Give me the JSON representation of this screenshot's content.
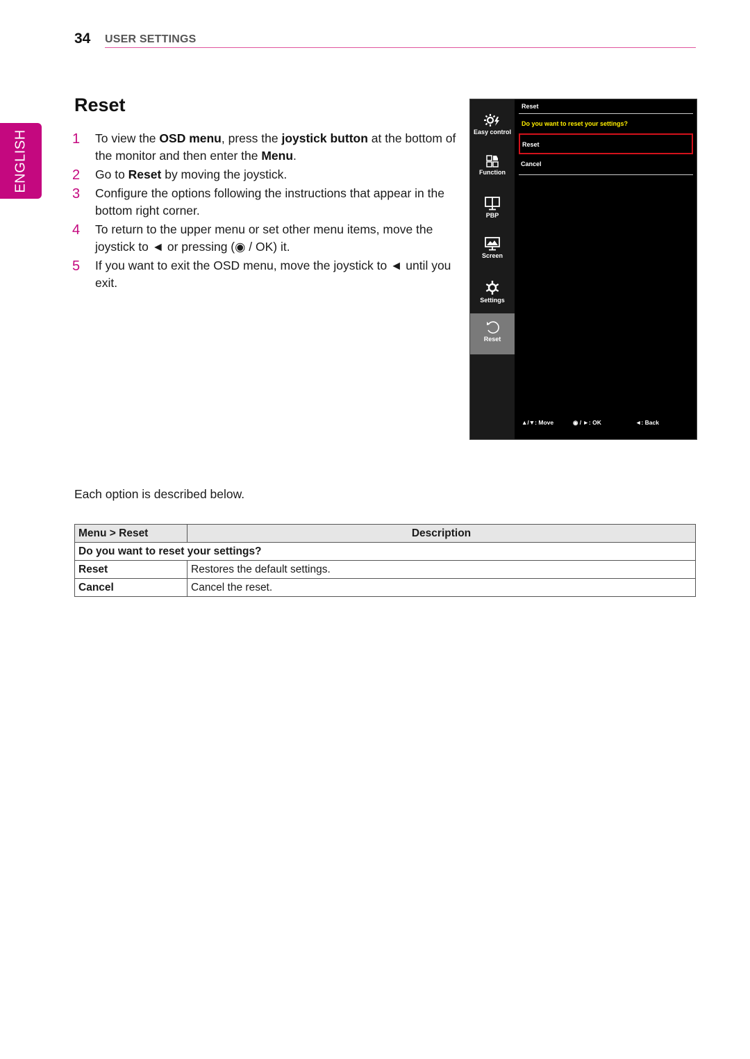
{
  "header": {
    "page_number": "34",
    "section_title": "USER SETTINGS"
  },
  "language_tab": "ENGLISH",
  "heading": "Reset",
  "steps": [
    {
      "num": "1",
      "parts": [
        [
          "To view the ",
          false
        ],
        [
          "OSD menu",
          true
        ],
        [
          ", press the ",
          false
        ],
        [
          "joystick button",
          true
        ],
        [
          " at the bottom of the monitor and then enter the ",
          false
        ],
        [
          "Menu",
          true
        ],
        [
          ".",
          false
        ]
      ]
    },
    {
      "num": "2",
      "parts": [
        [
          "Go to ",
          false
        ],
        [
          "Reset",
          true
        ],
        [
          " by moving the joystick.",
          false
        ]
      ]
    },
    {
      "num": "3",
      "parts": [
        [
          "Configure the options following the instructions that appear in the bottom right corner.",
          false
        ]
      ]
    },
    {
      "num": "4",
      "parts": [
        [
          "To return to the upper menu or set other menu items, move the joystick to ◄ or pressing (◉ / OK) it.",
          false
        ]
      ]
    },
    {
      "num": "5",
      "parts": [
        [
          "If you want to exit the OSD menu, move the joystick to ◄ until you exit.",
          false
        ]
      ]
    }
  ],
  "osd": {
    "sidebar": [
      {
        "label": "Easy control",
        "icon": "easy-control-icon"
      },
      {
        "label": "Function",
        "icon": "function-icon"
      },
      {
        "label": "PBP",
        "icon": "pbp-icon"
      },
      {
        "label": "Screen",
        "icon": "screen-icon"
      },
      {
        "label": "Settings",
        "icon": "settings-icon"
      },
      {
        "label": "Reset",
        "icon": "reset-icon",
        "active": true
      }
    ],
    "title": "Reset",
    "question": "Do you want to reset your settings?",
    "options": [
      {
        "label": "Reset",
        "selected": true
      },
      {
        "label": "Cancel",
        "selected": false
      }
    ],
    "footer": {
      "move": "▲/▼: Move",
      "ok": "◉ / ►: OK",
      "back": "◄: Back"
    },
    "colors": {
      "highlight": "#d3121b",
      "question": "#ffee00"
    }
  },
  "intro": "Each option is described below.",
  "table": {
    "headers": [
      "Menu > Reset",
      "Description"
    ],
    "section_row": "Do you want to reset your settings?",
    "rows": [
      {
        "name": "Reset",
        "desc": "Restores the default settings."
      },
      {
        "name": "Cancel",
        "desc": "Cancel the reset."
      }
    ]
  },
  "colors": {
    "accent": "#c4087f",
    "rule": "#e0559e"
  }
}
